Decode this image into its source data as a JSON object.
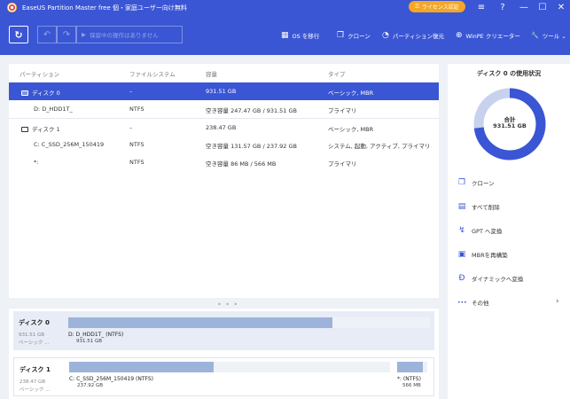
{
  "titlebar": {
    "title": "EaseUS Partition Master free 個・家庭ユーザー向け無料",
    "license_label": "ライセンス認証",
    "license_icon": "key-icon",
    "menu_icon": "≡",
    "help_icon": "?",
    "minimize_icon": "—",
    "maximize_icon": "☐",
    "close_icon": "✕"
  },
  "toolbar": {
    "refresh_icon": "↻",
    "undo_icon": "↶",
    "redo_icon": "↷",
    "execute_icon": "▶",
    "execute_label": "保留中の操作はありません",
    "actions": [
      {
        "icon": "▦",
        "label": "OS を移行"
      },
      {
        "icon": "❐",
        "label": "クローン"
      },
      {
        "icon": "◔",
        "label": "パーティション復元"
      },
      {
        "icon": "⊕",
        "label": "WinPE クリエーター"
      },
      {
        "icon": "🔧",
        "label": "ツール ⌄"
      }
    ]
  },
  "table": {
    "headers": [
      "パーティション",
      "ファイルシステム",
      "容量",
      "タイプ"
    ],
    "rows": [
      {
        "name": "ディスク 0",
        "fs": "–",
        "capacity": "931.51 GB",
        "type": "ベーシック, MBR",
        "is_disk": true
      },
      {
        "name": "D: D_HDD1T_",
        "fs": "NTFS",
        "capacity": "空き容量 247.47 GB / 931.51 GB",
        "type": "プライマリ",
        "is_disk": false
      },
      {
        "name": "ディスク 1",
        "fs": "–",
        "capacity": "238.47 GB",
        "type": "ベーシック, MBR",
        "is_disk": true
      },
      {
        "name": "C: C_SSD_256M_150419",
        "fs": "NTFS",
        "capacity": "空き容量 131.57 GB / 237.92 GB",
        "type": "システム, 起動, アクティブ, プライマリ",
        "is_disk": false
      },
      {
        "name": "*:",
        "fs": "NTFS",
        "capacity": "空き容量 86 MB / 566 MB",
        "type": "プライマリ",
        "is_disk": false
      }
    ],
    "splitter": "• • •"
  },
  "diskmap": {
    "disks": [
      {
        "name": "ディスク 0",
        "size": "931.51 GB",
        "type": "ベーシック ...",
        "partitions": [
          {
            "label": "D: D_HDD1T_ (NTFS)",
            "size": "931.51 GB",
            "used_fraction": 0.73
          }
        ]
      },
      {
        "name": "ディスク 1",
        "size": "238.47 GB",
        "type": "ベーシック ...",
        "partitions": [
          {
            "label": "C: C_SSD_256M_150419 (NTFS)",
            "size": "237.92 GB",
            "used_fraction": 0.45
          },
          {
            "label": "*: (NTFS)",
            "size": "566 MB",
            "used_fraction": 0.85
          }
        ]
      }
    ]
  },
  "sidepanel": {
    "title": "ディスク 0 の使用状況",
    "total_label": "合計",
    "total_size": "931.51 GB",
    "used_fraction": 0.73,
    "used_color": "#3a56d4",
    "free_color": "#c7d2ee",
    "actions": [
      {
        "icon": "❐",
        "label": "クローン"
      },
      {
        "icon": "▤",
        "label": "すべて削除"
      },
      {
        "icon": "↯",
        "label": "GPT へ変換"
      },
      {
        "icon": "▣",
        "label": "MBRを再構築"
      },
      {
        "icon": "Ð",
        "label": "ダイナミックへ変換"
      },
      {
        "icon": "•••",
        "label": "その他"
      }
    ],
    "more_chevron": "›"
  },
  "colors": {
    "accent": "#3a56d4",
    "license": "#f5a623",
    "bar": "#9db3d9"
  }
}
